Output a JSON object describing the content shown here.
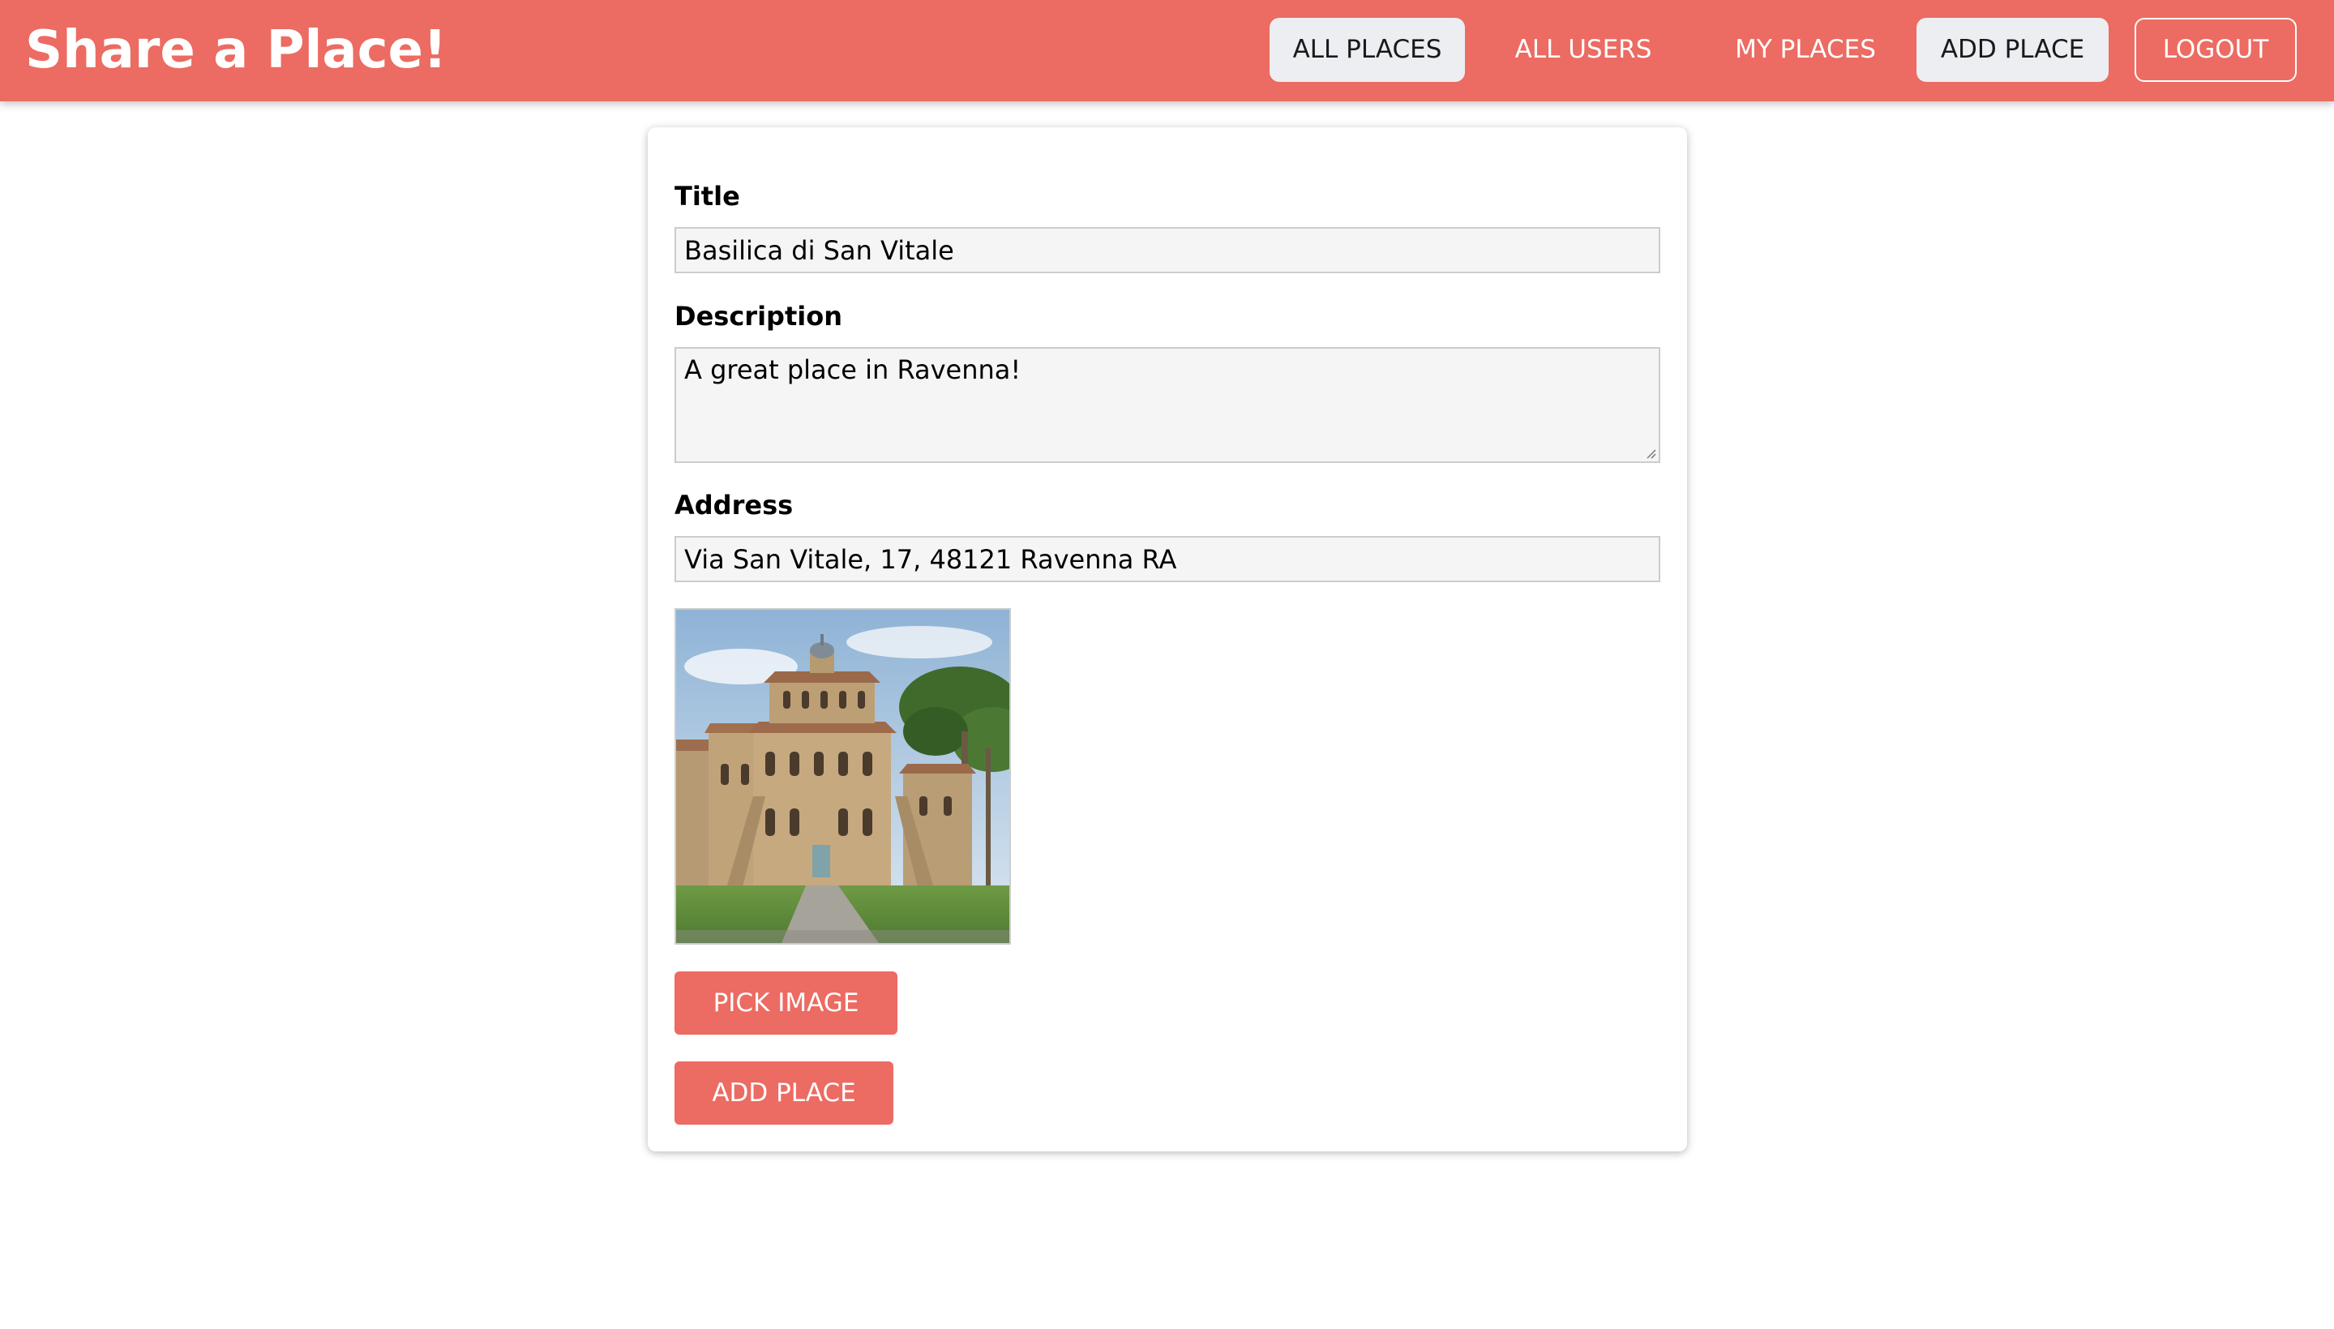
{
  "header": {
    "brand": "Share a Place!",
    "nav": {
      "all_places": "ALL PLACES",
      "all_users": "ALL USERS",
      "my_places": "MY PLACES",
      "add_place": "ADD PLACE",
      "logout": "LOGOUT"
    },
    "active_nav": [
      "ALL PLACES",
      "ADD PLACE"
    ]
  },
  "form": {
    "title": {
      "label": "Title",
      "value": "Basilica di San Vitale"
    },
    "description": {
      "label": "Description",
      "value": "A great place in Ravenna!"
    },
    "address": {
      "label": "Address",
      "value": "Via San Vitale, 17, 48121 Ravenna RA"
    },
    "image_preview": {
      "subject": "basilica-photo"
    },
    "pick_image_label": "PICK IMAGE",
    "submit_label": "ADD PLACE"
  },
  "colors": {
    "accent": "#ec6b62",
    "active_nav_bg": "#eceef1",
    "input_bg": "#f5f5f5",
    "input_border": "#cccccc"
  }
}
